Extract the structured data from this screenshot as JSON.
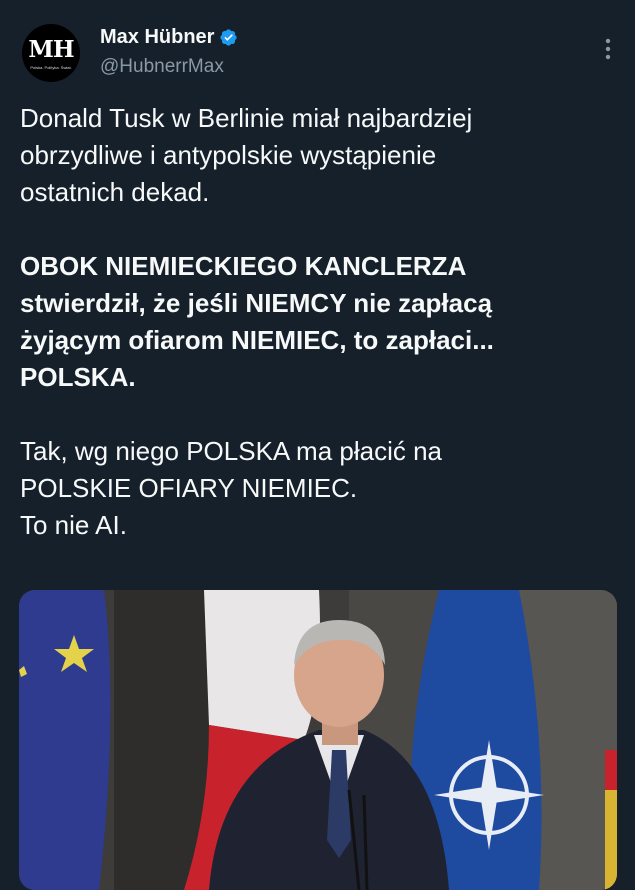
{
  "author": {
    "display_name": "Max Hübner",
    "handle": "@HubnerrMax",
    "avatar_logo": "MH",
    "avatar_tagline": "Polska. Polityka. Świat.",
    "verified_icon": "verified-badge-icon",
    "more_icon": "more-vertical-icon"
  },
  "tweet": {
    "paragraphs": [
      {
        "lines": [
          "Donald Tusk w Berlinie miał najbardziej",
          "obrzydliwe i antypolskie wystąpienie",
          "ostatnich dekad."
        ],
        "bold": false
      },
      {
        "lines": [
          "OBOK NIEMIECKIEGO KANCLERZA",
          "stwierdził, że jeśli NIEMCY nie zapłacą",
          "żyjącym ofiarom NIEMIEC, to zapłaci...",
          "POLSKA."
        ],
        "bold": true
      },
      {
        "lines": [
          "Tak, wg niego POLSKA ma płacić na",
          "POLSKIE OFIARY NIEMIEC.",
          "To nie AI."
        ],
        "bold": false
      }
    ]
  },
  "media": {
    "description_icon": "photo-media",
    "colors": {
      "eu_blue": "#2f3b8f",
      "eu_star": "#e3d24a",
      "nato_blue": "#1e4aa0",
      "pl_white": "#e8e6e6",
      "pl_red": "#c8232c"
    }
  },
  "colors": {
    "background": "#15202b",
    "text": "#f7f9f9",
    "secondary": "#8b98a5",
    "verified": "#1d9bf0"
  }
}
